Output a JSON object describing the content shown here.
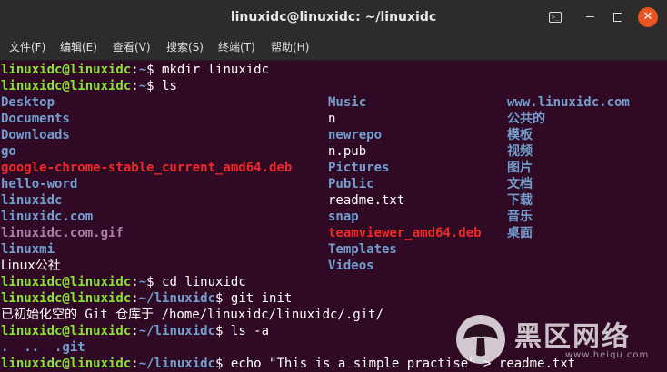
{
  "window": {
    "title": "linuxidc@linuxidc: ~/linuxidc"
  },
  "menu": {
    "items": [
      "文件(F)",
      "编辑(E)",
      "查看(V)",
      "搜索(S)",
      "终端(T)",
      "帮助(H)"
    ]
  },
  "colors": {
    "background": "#300a24",
    "prompt_user": "#8ae234",
    "prompt_path": "#729fcf",
    "directory": "#729fcf",
    "archive": "#ef2929",
    "image": "#ad7fa8",
    "close_button": "#e95420"
  },
  "icons": {
    "terminal": "terminal-icon",
    "minimize": "minimize-icon",
    "maximize": "maximize-icon",
    "close": "close-icon"
  },
  "terminal": {
    "prompt_user": "linuxidc@linuxidc",
    "lines": [
      {
        "user": "linuxidc@linuxidc",
        "sep": ":",
        "path": "~",
        "cmd": "$ mkdir linuxidc"
      },
      {
        "user": "linuxidc@linuxidc",
        "sep": ":",
        "path": "~",
        "cmd": "$ ls"
      }
    ],
    "ls_col1": [
      {
        "name": "Desktop",
        "kind": "dir"
      },
      {
        "name": "Documents",
        "kind": "dir"
      },
      {
        "name": "Downloads",
        "kind": "dir"
      },
      {
        "name": "go",
        "kind": "dir"
      },
      {
        "name": "google-chrome-stable_current_amd64.deb",
        "kind": "deb"
      },
      {
        "name": "hello-word",
        "kind": "dir"
      },
      {
        "name": "linuxidc",
        "kind": "dir"
      },
      {
        "name": "linuxidc.com",
        "kind": "dir"
      },
      {
        "name": "linuxidc.com.gif",
        "kind": "gif"
      },
      {
        "name": "linuxmi",
        "kind": "dir"
      },
      {
        "name": "Linux公社",
        "kind": "plain"
      }
    ],
    "ls_col2": [
      {
        "name": "Music",
        "kind": "dir"
      },
      {
        "name": "n",
        "kind": "plain"
      },
      {
        "name": "newrepo",
        "kind": "dir"
      },
      {
        "name": "n.pub",
        "kind": "plain"
      },
      {
        "name": "Pictures",
        "kind": "dir"
      },
      {
        "name": "Public",
        "kind": "dir"
      },
      {
        "name": "readme.txt",
        "kind": "plain"
      },
      {
        "name": "snap",
        "kind": "dir"
      },
      {
        "name": "teamviewer_amd64.deb",
        "kind": "deb"
      },
      {
        "name": "Templates",
        "kind": "dir"
      },
      {
        "name": "Videos",
        "kind": "dir"
      }
    ],
    "ls_col3": [
      {
        "name": "www.linuxidc.com",
        "kind": "dir"
      },
      {
        "name": "公共的",
        "kind": "dir"
      },
      {
        "name": "模板",
        "kind": "dir"
      },
      {
        "name": "视频",
        "kind": "dir"
      },
      {
        "name": "图片",
        "kind": "dir"
      },
      {
        "name": "文档",
        "kind": "dir"
      },
      {
        "name": "下载",
        "kind": "dir"
      },
      {
        "name": "音乐",
        "kind": "dir"
      },
      {
        "name": "桌面",
        "kind": "dir"
      }
    ],
    "after": [
      {
        "type": "prompt",
        "path": "~",
        "cmd": "$ cd linuxidc"
      },
      {
        "type": "prompt",
        "path": "~/linuxidc",
        "cmd": "$ git init"
      },
      {
        "type": "output",
        "text": "已初始化空的 Git 仓库于 /home/linuxidc/linuxidc/.git/"
      },
      {
        "type": "prompt",
        "path": "~/linuxidc",
        "cmd": "$ ls -a"
      },
      {
        "type": "output_dirs",
        "text": ".  ..  .git"
      },
      {
        "type": "prompt",
        "path": "~/linuxidc",
        "cmd": "$ echo \"This is a simple practise\" > readme.txt"
      }
    ]
  },
  "watermark": {
    "text": "黑区网络",
    "sub": "www.heiqu.com"
  }
}
